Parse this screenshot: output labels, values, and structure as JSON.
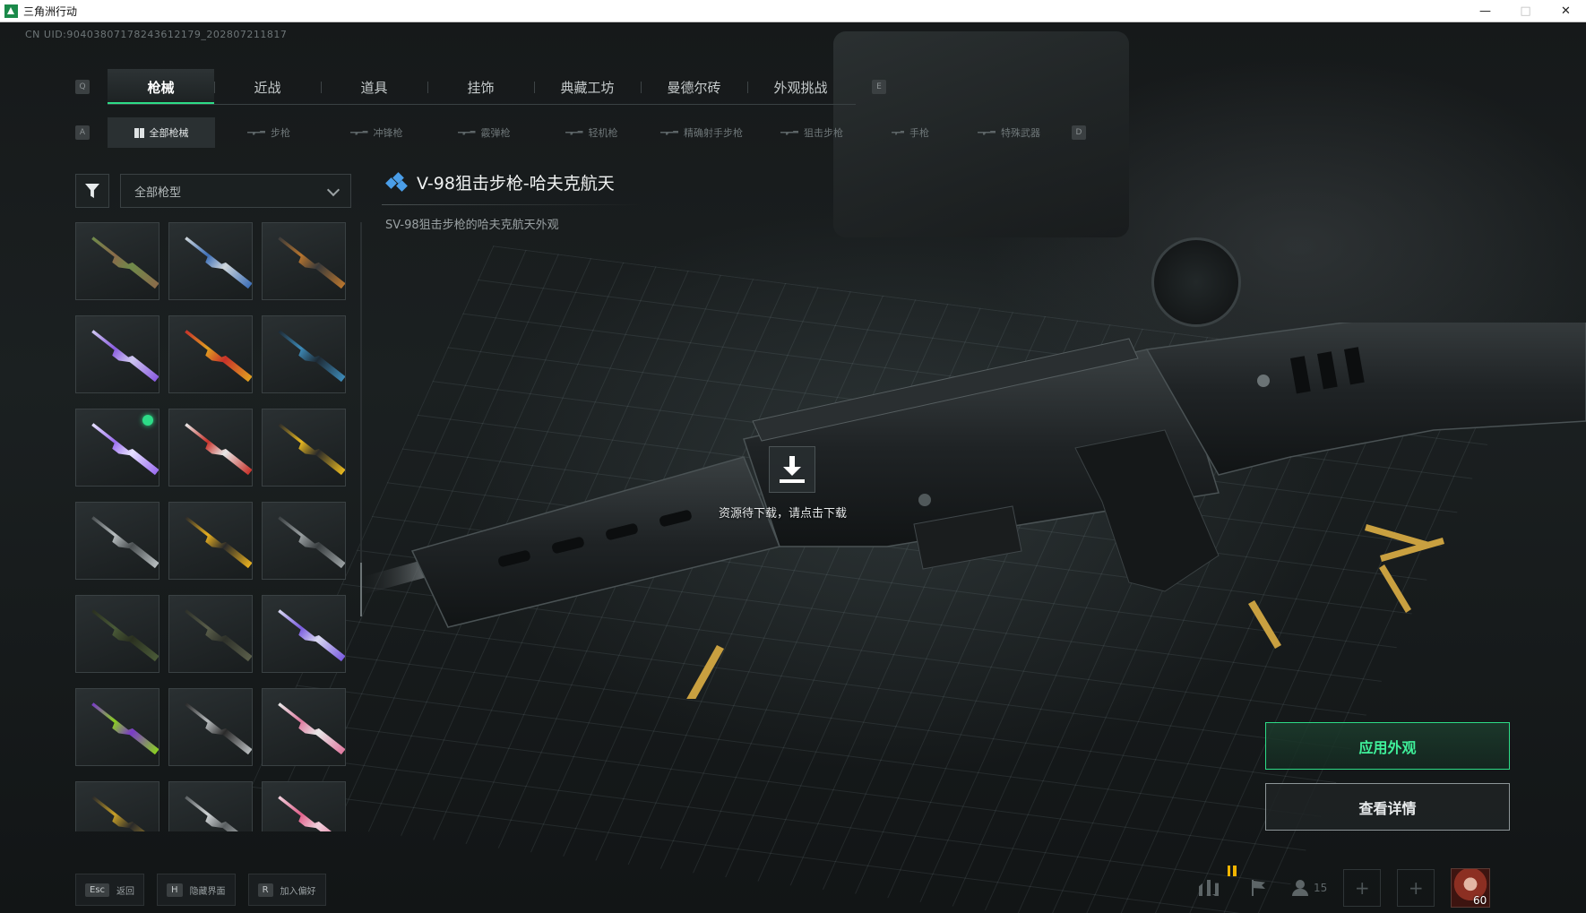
{
  "window": {
    "title": "三角洲行动",
    "controls": [
      "minimize",
      "maximize",
      "close"
    ]
  },
  "uid": "CN UID:9040380717824361217​9_202807211817",
  "main_tabs": {
    "prev_key": "Q",
    "next_key": "E",
    "items": [
      {
        "label": "枪械",
        "active": true
      },
      {
        "label": "近战",
        "active": false
      },
      {
        "label": "道具",
        "active": false
      },
      {
        "label": "挂饰",
        "active": false
      },
      {
        "label": "典藏工坊",
        "active": false
      },
      {
        "label": "曼德尔砖",
        "active": false
      },
      {
        "label": "外观挑战",
        "active": false
      }
    ]
  },
  "sub_tabs": {
    "prev_key": "A",
    "next_key": "D",
    "items": [
      {
        "label": "全部枪械",
        "icon": "grid-icon",
        "active": true
      },
      {
        "label": "步枪",
        "icon": "rifle-icon",
        "active": false
      },
      {
        "label": "冲锋枪",
        "icon": "smg-icon",
        "active": false
      },
      {
        "label": "霰弹枪",
        "icon": "shotgun-icon",
        "active": false
      },
      {
        "label": "轻机枪",
        "icon": "lmg-icon",
        "active": false
      },
      {
        "label": "精确射手步枪",
        "icon": "dmr-icon",
        "active": false
      },
      {
        "label": "狙击步枪",
        "icon": "sniper-icon",
        "active": false
      },
      {
        "label": "手枪",
        "icon": "pistol-icon",
        "active": false
      },
      {
        "label": "特殊武器",
        "icon": "special-icon",
        "active": false
      }
    ]
  },
  "filter": {
    "icon": "filter-icon",
    "selected": "全部枪型"
  },
  "skins": [
    {
      "color": "#8a6a4a",
      "accent": "#6f8a4a"
    },
    {
      "color": "#3d6fb8",
      "accent": "#cfd6da"
    },
    {
      "color": "#b8752e",
      "accent": "#3a3a3a"
    },
    {
      "color": "#8a5ce0",
      "accent": "#cfc8f0"
    },
    {
      "color": "#e0a020",
      "accent": "#c8322a"
    },
    {
      "color": "#3d8ab8",
      "accent": "#1e2a34"
    },
    {
      "color": "#9b6ef0",
      "accent": "#e6e0ff",
      "equipped": true
    },
    {
      "color": "#c8322a",
      "accent": "#e8e8e8"
    },
    {
      "color": "#e8b820",
      "accent": "#2a2a2a"
    },
    {
      "color": "#b8bec0",
      "accent": "#4a4f51"
    },
    {
      "color": "#e8b020",
      "accent": "#2a2a2a"
    },
    {
      "color": "#9aa0a2",
      "accent": "#3a3f41"
    },
    {
      "color": "#4a5a38",
      "accent": "#2a3020"
    },
    {
      "color": "#5a5e4a",
      "accent": "#2e312a"
    },
    {
      "color": "#7a5ce0",
      "accent": "#d8d8f0"
    },
    {
      "color": "#8ad020",
      "accent": "#7a3ac8"
    },
    {
      "color": "#b8bcbe",
      "accent": "#2a2a2a"
    },
    {
      "color": "#e07aa0",
      "accent": "#e8e8e8"
    },
    {
      "color": "#c8a028",
      "accent": "#2a2a2a"
    },
    {
      "color": "#d0d4d6",
      "accent": "#5a5f61"
    },
    {
      "color": "#e0608a",
      "accent": "#f0d0dc"
    }
  ],
  "skin_detail": {
    "title": "V-98狙击步枪-哈夫克航天",
    "subtitle": "SV-98狙击步枪的哈夫克航天外观",
    "title_icon": "diamond-icon",
    "rarity_color": "#4a9ee8"
  },
  "download": {
    "icon": "download-icon",
    "text": "资源待下载，请点击下载"
  },
  "actions": {
    "apply_label": "应用外观",
    "detail_label": "查看详情",
    "accent": "#2ddc87"
  },
  "bottom_hints": [
    {
      "key": "Esc",
      "label": "返回"
    },
    {
      "key": "H",
      "label": "隐藏界面"
    },
    {
      "key": "R",
      "label": "加入偏好"
    }
  ],
  "tray": {
    "stats_icon": "bar-chart-icon",
    "flag_icon": "flag-icon",
    "friends_icon": "friends-icon",
    "friends_count": "15",
    "avatar_level": "60"
  }
}
